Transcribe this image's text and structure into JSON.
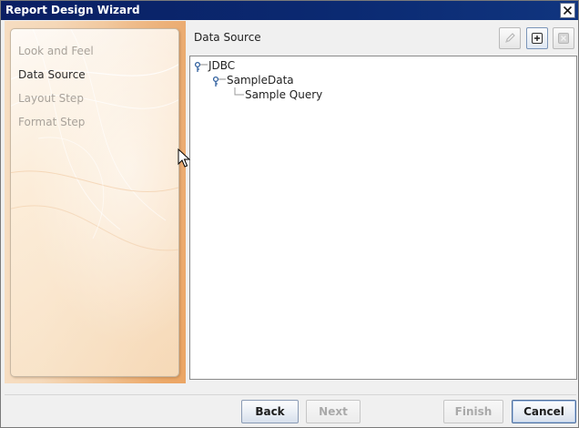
{
  "window": {
    "title": "Report Design Wizard"
  },
  "steps": [
    {
      "label": "Look and Feel",
      "state": "inactive"
    },
    {
      "label": "Data Source",
      "state": "active"
    },
    {
      "label": "Layout Step",
      "state": "inactive"
    },
    {
      "label": "Format Step",
      "state": "inactive"
    }
  ],
  "content": {
    "title": "Data Source",
    "toolbar": {
      "edit_icon": "pencil-icon",
      "add_icon": "plus-box-icon",
      "remove_icon": "close-box-icon"
    },
    "tree": [
      {
        "label": "JDBC",
        "level": 0,
        "icon": "connection-key-icon"
      },
      {
        "label": "SampleData",
        "level": 1,
        "icon": "connection-key-icon"
      },
      {
        "label": "Sample Query",
        "level": 2,
        "icon": "tree-line"
      }
    ]
  },
  "footer": {
    "back_label": "Back",
    "next_label": "Next",
    "finish_label": "Finish",
    "cancel_label": "Cancel"
  },
  "colors": {
    "titlebar": "#0a246a",
    "panel_accent": "#eeb380",
    "button_border": "#8a9bb5"
  }
}
